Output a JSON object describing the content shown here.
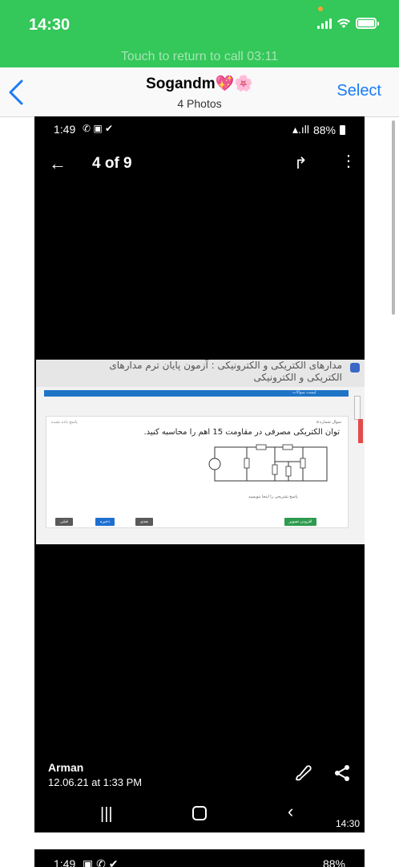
{
  "ios_status": {
    "time": "14:30",
    "call_banner": "Touch to return to call 03:11"
  },
  "nav": {
    "title": "Sogandm💖🌸",
    "subtitle": "4 Photos",
    "select_label": "Select"
  },
  "photo": {
    "status_time": "1:49",
    "status_left_icons": "✆ ▣ ✔",
    "status_right": "88%",
    "counter": "4 of 9",
    "page": {
      "title": "مدارهای الکتریکی و الکترونیکی : آزمون پایان ترم مدارهای الکتریکی و الکترونیکی",
      "blue_bar_text": "لیست سوالات",
      "question_number": "سوال شماره ۵",
      "question_sub": "پاسخ داده نشده",
      "question_text": "توان الکتریکی مصرفی در مقاومت 15 اهم را محاسبه کنید.",
      "answer_hint": "پاسخ تشریحی را اینجا بنویسید",
      "buttons": {
        "prev": "قبلی",
        "save": "ذخیره",
        "next": "بعدی",
        "upload": "افزودن تصویر"
      }
    },
    "owner": "Arman",
    "date": "12.06.21 at 1:33 PM",
    "nav_time": "14:30"
  },
  "photo2": {
    "status_time": "1:49",
    "status_left_icons": "▣ ✆ ✔",
    "status_right": "88%"
  },
  "colors": {
    "call_green": "#34c759",
    "ios_blue": "#1a7cf5",
    "page_blue": "#1f74c6",
    "upload_green": "#2e9b4f"
  }
}
